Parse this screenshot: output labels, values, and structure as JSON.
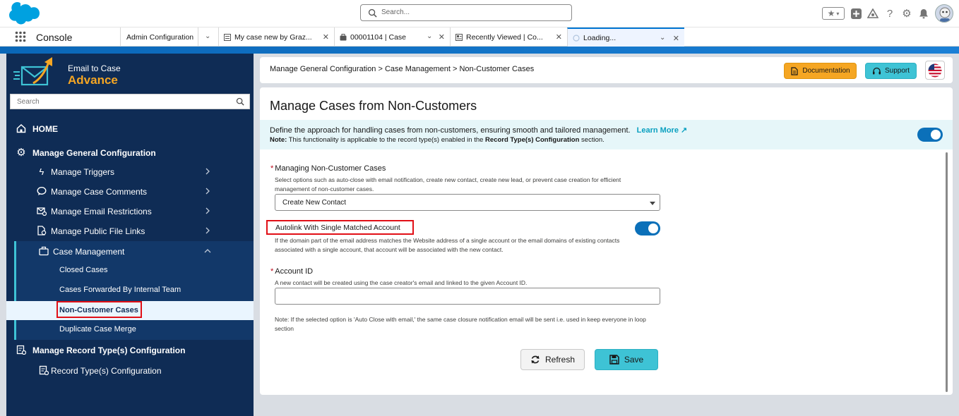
{
  "global_header": {
    "search_placeholder": "Search...",
    "icons": [
      "salesforce-cloud-icon",
      "favorites-star-icon",
      "chevron-down-icon",
      "global-add-icon",
      "trailhead-icon",
      "help-icon",
      "setup-gear-icon",
      "notification-bell-icon",
      "user-avatar"
    ]
  },
  "tab_bar": {
    "app_name": "Console",
    "tabs": [
      {
        "label": "Admin Configuration"
      },
      {
        "label": "My case new by Graz..."
      },
      {
        "label": "00001104 | Case"
      },
      {
        "label": "Recently Viewed | Co..."
      },
      {
        "label": "Loading..."
      }
    ]
  },
  "sidebar": {
    "brand_line1": "Email to Case",
    "brand_line2": "Advance",
    "search_placeholder": "Search",
    "home": "HOME",
    "general_config": "Manage General Configuration",
    "items": [
      {
        "label": "Manage Triggers"
      },
      {
        "label": "Manage Case Comments"
      },
      {
        "label": "Manage Email Restrictions"
      },
      {
        "label": "Manage Public File Links"
      }
    ],
    "case_management": "Case Management",
    "case_sub_items": [
      {
        "label": "Closed Cases"
      },
      {
        "label": "Cases Forwarded By Internal Team"
      },
      {
        "label": "Non-Customer Cases"
      },
      {
        "label": "Duplicate Case Merge"
      }
    ],
    "record_type_group": "Manage Record Type(s) Configuration",
    "record_type_item": "Record Type(s) Configuration"
  },
  "breadcrumb": {
    "text": "Manage General Configuration > Case Management > Non-Customer Cases"
  },
  "header_buttons": {
    "documentation": "Documentation",
    "support": "Support"
  },
  "main": {
    "title": "Manage Cases from Non-Customers",
    "description": "Define the approach for handling cases from non-customers, ensuring smooth and tailored management.",
    "learn_more": "Learn More",
    "note_prefix": "Note:",
    "note_text_1": " This functionality is applicable to the record type(s) enabled in the ",
    "note_bold": "Record Type(s) Configuration",
    "note_text_2": " section.",
    "feature_enabled": true,
    "managing_label": "Managing Non-Customer Cases",
    "managing_help": "Select options such as auto-close with email notification, create new contact, create new lead, or prevent case creation for efficient management of non-customer cases.",
    "managing_value": "Create New Contact",
    "autolink_label": "Autolink With Single Matched Account",
    "autolink_enabled": true,
    "autolink_help": "If the domain part of the email address matches the Website address of a single account or the email domains of existing contacts associated with a single account, that account will be associated with the new contact.",
    "account_id_label": "Account ID",
    "account_id_help": "A new contact will be created using the case creator's email and linked to the given Account ID.",
    "account_id_value": "",
    "bottom_note": "Note: If the selected option is 'Auto Close with email,' the same case closure notification email will be sent i.e. used in keep everyone in loop section",
    "refresh_label": "Refresh",
    "save_label": "Save"
  },
  "colors": {
    "sidebar_bg": "#0f2c55",
    "accent_orange": "#f5a623",
    "accent_cyan": "#3ec3d5",
    "toggle_blue": "#0b70b9",
    "highlight_red": "#e10f16"
  }
}
